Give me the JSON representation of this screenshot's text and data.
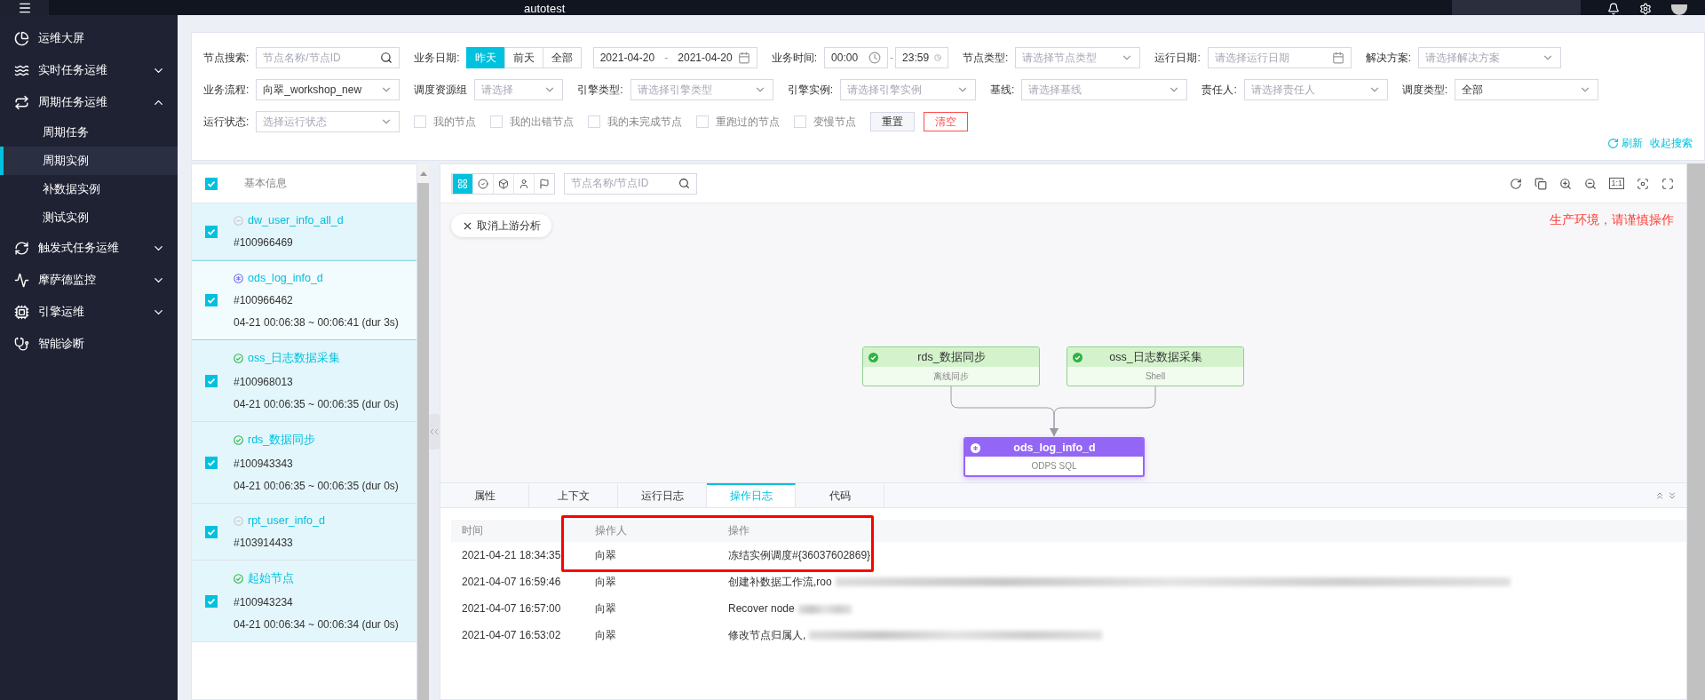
{
  "header": {
    "project": "autotest"
  },
  "sidebar": {
    "items": [
      {
        "label": "运维大屏",
        "selected": false
      },
      {
        "label": "实时任务运维",
        "selected": false,
        "expanded": false
      },
      {
        "label": "周期任务运维",
        "selected": false,
        "expanded": true,
        "children": [
          {
            "label": "周期任务",
            "selected": false
          },
          {
            "label": "周期实例",
            "selected": true
          },
          {
            "label": "补数据实例",
            "selected": false
          },
          {
            "label": "测试实例",
            "selected": false
          }
        ]
      },
      {
        "label": "触发式任务运维",
        "selected": false,
        "expanded": false
      },
      {
        "label": "摩萨德监控",
        "selected": false,
        "expanded": false
      },
      {
        "label": "引擎运维",
        "selected": false,
        "expanded": false
      },
      {
        "label": "智能诊断",
        "selected": false
      }
    ]
  },
  "filters": {
    "fields": [
      {
        "kind": "search",
        "label": "节点搜索:",
        "placeholder": "节点名称/节点ID"
      },
      {
        "kind": "segmented",
        "label": "业务日期:",
        "options": [
          {
            "label": "昨天",
            "selected": true
          },
          {
            "label": "前天",
            "selected": false
          },
          {
            "label": "全部",
            "selected": false
          }
        ],
        "from": "2021-04-20",
        "separator": "-",
        "to": "2021-04-20"
      },
      {
        "kind": "timerange",
        "label": "业务时间:",
        "from": "00:00",
        "separator": "-",
        "to": "23:59"
      },
      {
        "kind": "select",
        "label": "节点类型:",
        "placeholder": "请选择节点类型"
      },
      {
        "kind": "date",
        "label": "运行日期:",
        "placeholder": "请选择运行日期"
      },
      {
        "kind": "select",
        "label": "解决方案:",
        "placeholder": "请选择解决方案"
      },
      {
        "kind": "select",
        "label": "业务流程:",
        "value": "向翠_workshop_new"
      },
      {
        "kind": "select",
        "label": "调度资源组",
        "placeholder": "请选择"
      },
      {
        "kind": "select",
        "label": "引擎类型:",
        "placeholder": "请选择引擎类型"
      },
      {
        "kind": "select",
        "label": "引擎实例:",
        "placeholder": "请选择引擎实例"
      },
      {
        "kind": "select",
        "label": "基线:",
        "placeholder": "请选择基线"
      },
      {
        "kind": "select",
        "label": "责任人:",
        "placeholder": "请选择责任人"
      },
      {
        "kind": "select",
        "label": "调度类型:",
        "value": "全部"
      },
      {
        "kind": "select",
        "label": "运行状态:",
        "placeholder": "选择运行状态"
      },
      {
        "kind": "checkbox",
        "label": "我的节点",
        "checked": false
      },
      {
        "kind": "checkbox",
        "label": "我的出错节点",
        "checked": false
      },
      {
        "kind": "checkbox",
        "label": "我的未完成节点",
        "checked": false
      },
      {
        "kind": "checkbox",
        "label": "重跑过的节点",
        "checked": false
      },
      {
        "kind": "checkbox",
        "label": "变慢节点",
        "checked": false
      },
      {
        "kind": "button",
        "label": "重置"
      },
      {
        "kind": "danger",
        "label": "清空"
      }
    ],
    "links": [
      "刷新",
      "收起搜索"
    ]
  },
  "instance_list": {
    "header": "基本信息",
    "all_checked": true,
    "items": [
      {
        "name": "dw_user_info_all_d",
        "kind": "waiting",
        "id": "#100966469",
        "checked": true,
        "selected": false
      },
      {
        "name": "ods_log_info_d",
        "kind": "running",
        "id": "#100966462",
        "time": "04-21 00:06:38 ~ 00:06:41 (dur 3s)",
        "checked": true,
        "selected": true
      },
      {
        "name": "oss_日志数据采集",
        "kind": "success",
        "id": "#100968013",
        "time": "04-21 00:06:35 ~ 00:06:35 (dur 0s)",
        "checked": true,
        "selected": false
      },
      {
        "name": "rds_数据同步",
        "kind": "success",
        "id": "#100943343",
        "time": "04-21 00:06:35 ~ 00:06:35 (dur 0s)",
        "checked": true,
        "selected": false
      },
      {
        "name": "rpt_user_info_d",
        "kind": "waiting",
        "id": "#103914433",
        "checked": true,
        "selected": false
      },
      {
        "name": "起始节点",
        "kind": "success",
        "id": "#100943234",
        "time": "04-21 00:06:34 ~ 00:06:34 (dur 0s)",
        "checked": true,
        "selected": false
      }
    ]
  },
  "graph": {
    "view_modes": [
      {
        "selected": true
      },
      {
        "selected": false
      },
      {
        "selected": false
      },
      {
        "selected": false
      },
      {
        "selected": false
      }
    ],
    "search_placeholder": "节点名称/节点ID",
    "actual_size": "1:1",
    "cancel_button": "取消上游分析",
    "warning": "生产环境，请谨慎操作",
    "nodes": [
      {
        "name": "rds_数据同步",
        "type": "离线同步",
        "kind": "success"
      },
      {
        "name": "oss_日志数据采集",
        "type": "Shell",
        "kind": "success"
      },
      {
        "name": "ods_log_info_d",
        "type": "ODPS SQL",
        "kind": "running"
      }
    ]
  },
  "detail": {
    "tabs": [
      {
        "label": "属性",
        "selected": false
      },
      {
        "label": "上下文",
        "selected": false
      },
      {
        "label": "运行日志",
        "selected": false
      },
      {
        "label": "操作日志",
        "selected": true
      },
      {
        "label": "代码",
        "selected": false
      }
    ],
    "columns": [
      "时间",
      "操作人",
      "操作"
    ],
    "rows": [
      {
        "time": "2021-04-21 18:34:35",
        "operator": "向翠",
        "action": "冻结实例调度#{36037602869}",
        "redacted": false
      },
      {
        "time": "2021-04-07 16:59:46",
        "operator": "向翠",
        "action": "创建补数据工作流,roo",
        "redacted": true
      },
      {
        "time": "2021-04-07 16:57:00",
        "operator": "向翠",
        "action": "Recover node",
        "redacted": true
      },
      {
        "time": "2021-04-07 16:53:02",
        "operator": "向翠",
        "action": "修改节点归属人,",
        "redacted": true
      }
    ],
    "highlight_frame": true
  }
}
